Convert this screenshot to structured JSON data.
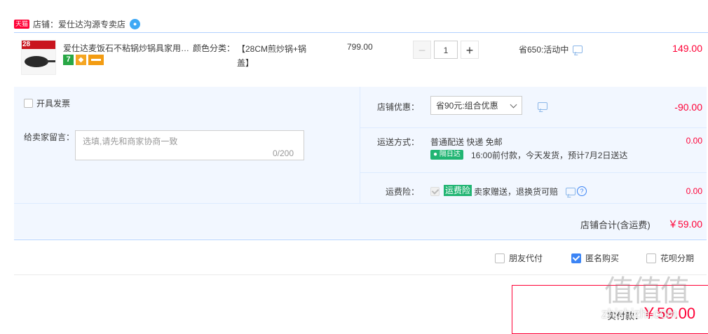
{
  "shop": {
    "badge": "天猫",
    "label": "店铺：爱仕达沟源专卖店",
    "ww_icon": "wangwang-chat-icon"
  },
  "item": {
    "thumb_num": "28",
    "title": "爱仕达麦饭石不粘锅炒锅具家用…",
    "badge_7": "7",
    "badge_shield": "盾",
    "sku_label": "颜色分类：",
    "sku_value": "【28CM煎炒锅+锅盖】",
    "price": "799.00",
    "quantity": "1",
    "minus": "−",
    "plus": "+",
    "promo": "省650:活动中",
    "subtotal": "149.00"
  },
  "invoice": {
    "label": "开具发票"
  },
  "memo": {
    "label": "给卖家留言：",
    "placeholder": "选填,请先和商家协商一致",
    "count": "0/200"
  },
  "discount": {
    "label": "店铺优惠：",
    "selected": "省90元:组合优惠",
    "amount": "-90.00"
  },
  "shipping": {
    "label": "运送方式：",
    "method": "普通配送 快递 免邮",
    "tag": "隔日达",
    "detail": "16:00前付款，今天发货，预计7月2日送达",
    "amount": "0.00"
  },
  "insurance": {
    "label": "运费险：",
    "tag": "运费险",
    "text": "卖家赠送，退换货可赔",
    "help": "?",
    "amount": "0.00"
  },
  "total": {
    "label": "店铺合计(含运费)",
    "amount": "￥59.00"
  },
  "options": {
    "friend_pay": "朋友代付",
    "anonymous": "匿名购买",
    "anonymous_checked": true,
    "huabei": "花呗分期"
  },
  "pay": {
    "label": "实付款：",
    "amount": "￥59.00"
  },
  "watermark": {
    "logo": "值值值",
    "site": "zhizhizhi.com"
  },
  "colors": {
    "accent_red": "#ff0036",
    "accent_blue": "#3b84f5",
    "panel_bg": "#f2f7ff",
    "green_tag": "#21b573"
  }
}
